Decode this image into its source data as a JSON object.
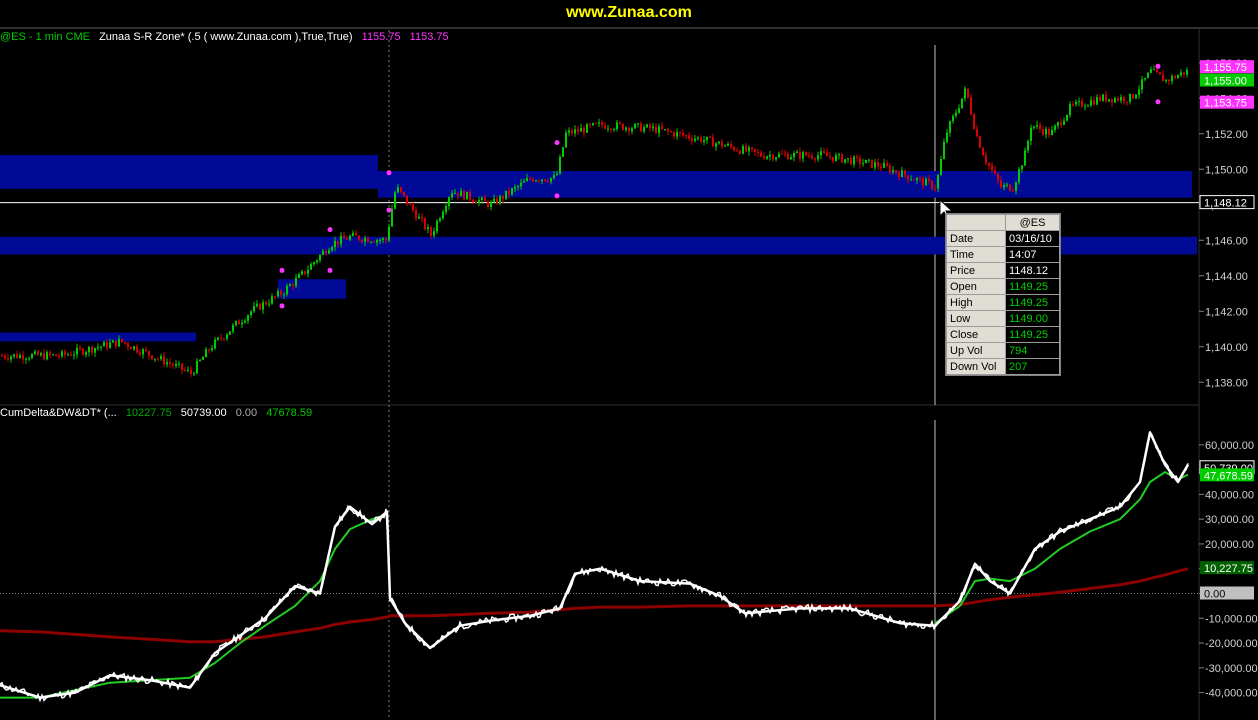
{
  "header": {
    "site": "www.Zunaa.com",
    "color": "#ffff00"
  },
  "price_panel": {
    "symbol_info": "@ES - 1 min  CME",
    "indicator": "Zunaa S-R Zone* (.5 (  www.Zunaa.com  ),True,True)",
    "values": [
      "1155.75",
      "1153.75"
    ]
  },
  "delta_panel": {
    "indicator": "CumDelta&DW&DT* (...",
    "values": [
      "10227.75",
      "50739.00",
      "0.00",
      "47678.59"
    ]
  },
  "data_window": {
    "title": "@ES",
    "rows": [
      {
        "label": "Date",
        "value": "03/16/10"
      },
      {
        "label": "Time",
        "value": "14:07"
      },
      {
        "label": "Price",
        "value": "1148.12"
      },
      {
        "label": "Open",
        "value": "1149.25"
      },
      {
        "label": "High",
        "value": "1149.25"
      },
      {
        "label": "Low",
        "value": "1149.00"
      },
      {
        "label": "Close",
        "value": "1149.25"
      },
      {
        "label": "Up Vol",
        "value": "794"
      },
      {
        "label": "Down Vol",
        "value": "207"
      }
    ]
  },
  "colors": {
    "up_bar": "#00cc00",
    "down_bar": "#dd0000",
    "zone": "#000a96",
    "cum_delta": "#ffffff",
    "avg_fast": "#22cc22",
    "avg_slow": "#8b0000",
    "marker": "#ff33ff"
  },
  "chart_data": [
    {
      "type": "candlestick",
      "title": "",
      "ylim": [
        1137,
        1157
      ],
      "y_ticks": [
        "1,138.00",
        "1,140.00",
        "1,142.00",
        "1,144.00",
        "1,146.00",
        "1,148.00",
        "1,150.00",
        "1,152.00",
        "1,154.00",
        "1,156.00"
      ],
      "y_tick_values": [
        1138,
        1140,
        1142,
        1144,
        1146,
        1148,
        1150,
        1152,
        1154,
        1156
      ],
      "price_labels": [
        {
          "text": "1,155.75",
          "value": 1155.75,
          "color": "#ff33ff"
        },
        {
          "text": "1,155.00",
          "value": 1155.0,
          "color": "#00cc00"
        },
        {
          "text": "1,153.75",
          "value": 1153.75,
          "color": "#ff33ff"
        },
        {
          "text": "1,148.12",
          "value": 1148.12,
          "color": "#ffffff"
        }
      ],
      "crosshair_price": 1148.12,
      "path_x": [
        0,
        60,
        120,
        190,
        210,
        250,
        280,
        300,
        330,
        350,
        385,
        395,
        430,
        450,
        490,
        530,
        555,
        565,
        600,
        650,
        700,
        760,
        820,
        880,
        935,
        945,
        965,
        975,
        985,
        1000,
        1012,
        1025,
        1030,
        1050,
        1070,
        1100,
        1130,
        1150,
        1165,
        1185
      ],
      "path_y": [
        1139.5,
        1139.5,
        1140.3,
        1138.5,
        1140,
        1142,
        1143,
        1144,
        1145.8,
        1146.2,
        1146,
        1149,
        1146.3,
        1148.8,
        1148,
        1149.5,
        1149.5,
        1152,
        1152.5,
        1152.3,
        1151.7,
        1150.8,
        1150.8,
        1150.2,
        1149,
        1152,
        1154.5,
        1152,
        1150.5,
        1149,
        1149,
        1151,
        1152.5,
        1152,
        1153.5,
        1154,
        1154,
        1155.5,
        1155,
        1155.5
      ],
      "zones": [
        {
          "x0": 0,
          "x1": 378,
          "ymin": 1148.9,
          "ymax": 1150.8
        },
        {
          "x0": 378,
          "x1": 1192,
          "ymin": 1148.4,
          "ymax": 1149.9
        },
        {
          "x0": 0,
          "x1": 1197,
          "ymin": 1145.2,
          "ymax": 1146.2
        },
        {
          "x0": 278,
          "x1": 346,
          "ymin": 1142.7,
          "ymax": 1143.8
        },
        {
          "x0": 0,
          "x1": 196,
          "ymin": 1140.3,
          "ymax": 1140.8
        }
      ],
      "markers": [
        {
          "x": 282,
          "y": 1144.3
        },
        {
          "x": 282,
          "y": 1142.3
        },
        {
          "x": 330,
          "y": 1146.6
        },
        {
          "x": 330,
          "y": 1144.3
        },
        {
          "x": 389,
          "y": 1149.8
        },
        {
          "x": 389,
          "y": 1147.7
        },
        {
          "x": 557,
          "y": 1151.5
        },
        {
          "x": 557,
          "y": 1148.5
        },
        {
          "x": 1158,
          "y": 1155.8
        },
        {
          "x": 1158,
          "y": 1153.8
        }
      ]
    },
    {
      "type": "line",
      "title": "",
      "ylim": [
        -45000,
        68000
      ],
      "y_ticks": [
        "-40,000.00",
        "-30,000.00",
        "-20,000.00",
        "-10,000.00",
        "0.00",
        "10,000.00",
        "20,000.00",
        "30,000.00",
        "40,000.00",
        "50,000.00",
        "60,000.00"
      ],
      "y_tick_values": [
        -40000,
        -30000,
        -20000,
        -10000,
        0,
        10000,
        20000,
        30000,
        40000,
        50000,
        60000
      ],
      "value_labels": [
        {
          "text": "50,739.00",
          "value": 50739,
          "color": "#ffffff"
        },
        {
          "text": "47,678.59",
          "value": 47678.59,
          "color": "#00cc00"
        },
        {
          "text": "10,227.75",
          "value": 10227.75,
          "color": "#006000"
        },
        {
          "text": "0.00",
          "value": 0,
          "color": "#c0c0c0"
        }
      ],
      "x": [
        0,
        40,
        75,
        110,
        150,
        190,
        215,
        240,
        265,
        295,
        320,
        335,
        350,
        372,
        387,
        390,
        405,
        430,
        460,
        490,
        530,
        560,
        575,
        600,
        640,
        690,
        720,
        745,
        800,
        850,
        900,
        935,
        960,
        975,
        990,
        1010,
        1035,
        1060,
        1090,
        1120,
        1140,
        1150,
        1165,
        1178,
        1188
      ],
      "series": [
        {
          "name": "",
          "color": "#ffffff",
          "values": [
            -37000,
            -42000,
            -40000,
            -33000,
            -35000,
            -38000,
            -24000,
            -17000,
            -10000,
            3000,
            0,
            27000,
            35000,
            28000,
            33000,
            -2000,
            -12000,
            -22000,
            -13000,
            -11000,
            -9000,
            -6000,
            8000,
            10000,
            5000,
            4000,
            -1000,
            -8000,
            -6000,
            -6000,
            -12000,
            -13000,
            -3000,
            12000,
            5000,
            0,
            18000,
            25000,
            30000,
            35000,
            45000,
            65000,
            52000,
            45000,
            52000
          ]
        },
        {
          "name": "",
          "color": "#22cc22",
          "values": [
            -42000,
            -42000,
            -39000,
            -36000,
            -35000,
            -34000,
            -28000,
            -20000,
            -13000,
            -5000,
            5000,
            18000,
            26000,
            30000,
            32000,
            null,
            null,
            null,
            null,
            null,
            null,
            null,
            null,
            null,
            null,
            null,
            null,
            null,
            null,
            null,
            null,
            -12000,
            -5000,
            5000,
            6000,
            5000,
            10000,
            18000,
            25000,
            30000,
            38000,
            45000,
            49000,
            46000,
            48000
          ]
        },
        {
          "name": "",
          "color": "#8b0000",
          "values": [
            -15000,
            -15500,
            -16500,
            -17500,
            -18500,
            -19500,
            -19500,
            -18500,
            -17500,
            -15500,
            -14000,
            -12500,
            -11500,
            -10500,
            -9500,
            -9000,
            -9000,
            -9000,
            -8500,
            -8000,
            -7500,
            -6500,
            -6000,
            -5500,
            -5500,
            -5000,
            -5000,
            -5000,
            -5000,
            -5000,
            -5000,
            -5000,
            -4500,
            -3500,
            -2500,
            -1500,
            -500,
            500,
            2000,
            3500,
            5000,
            6000,
            7500,
            9000,
            10000
          ]
        }
      ]
    }
  ]
}
